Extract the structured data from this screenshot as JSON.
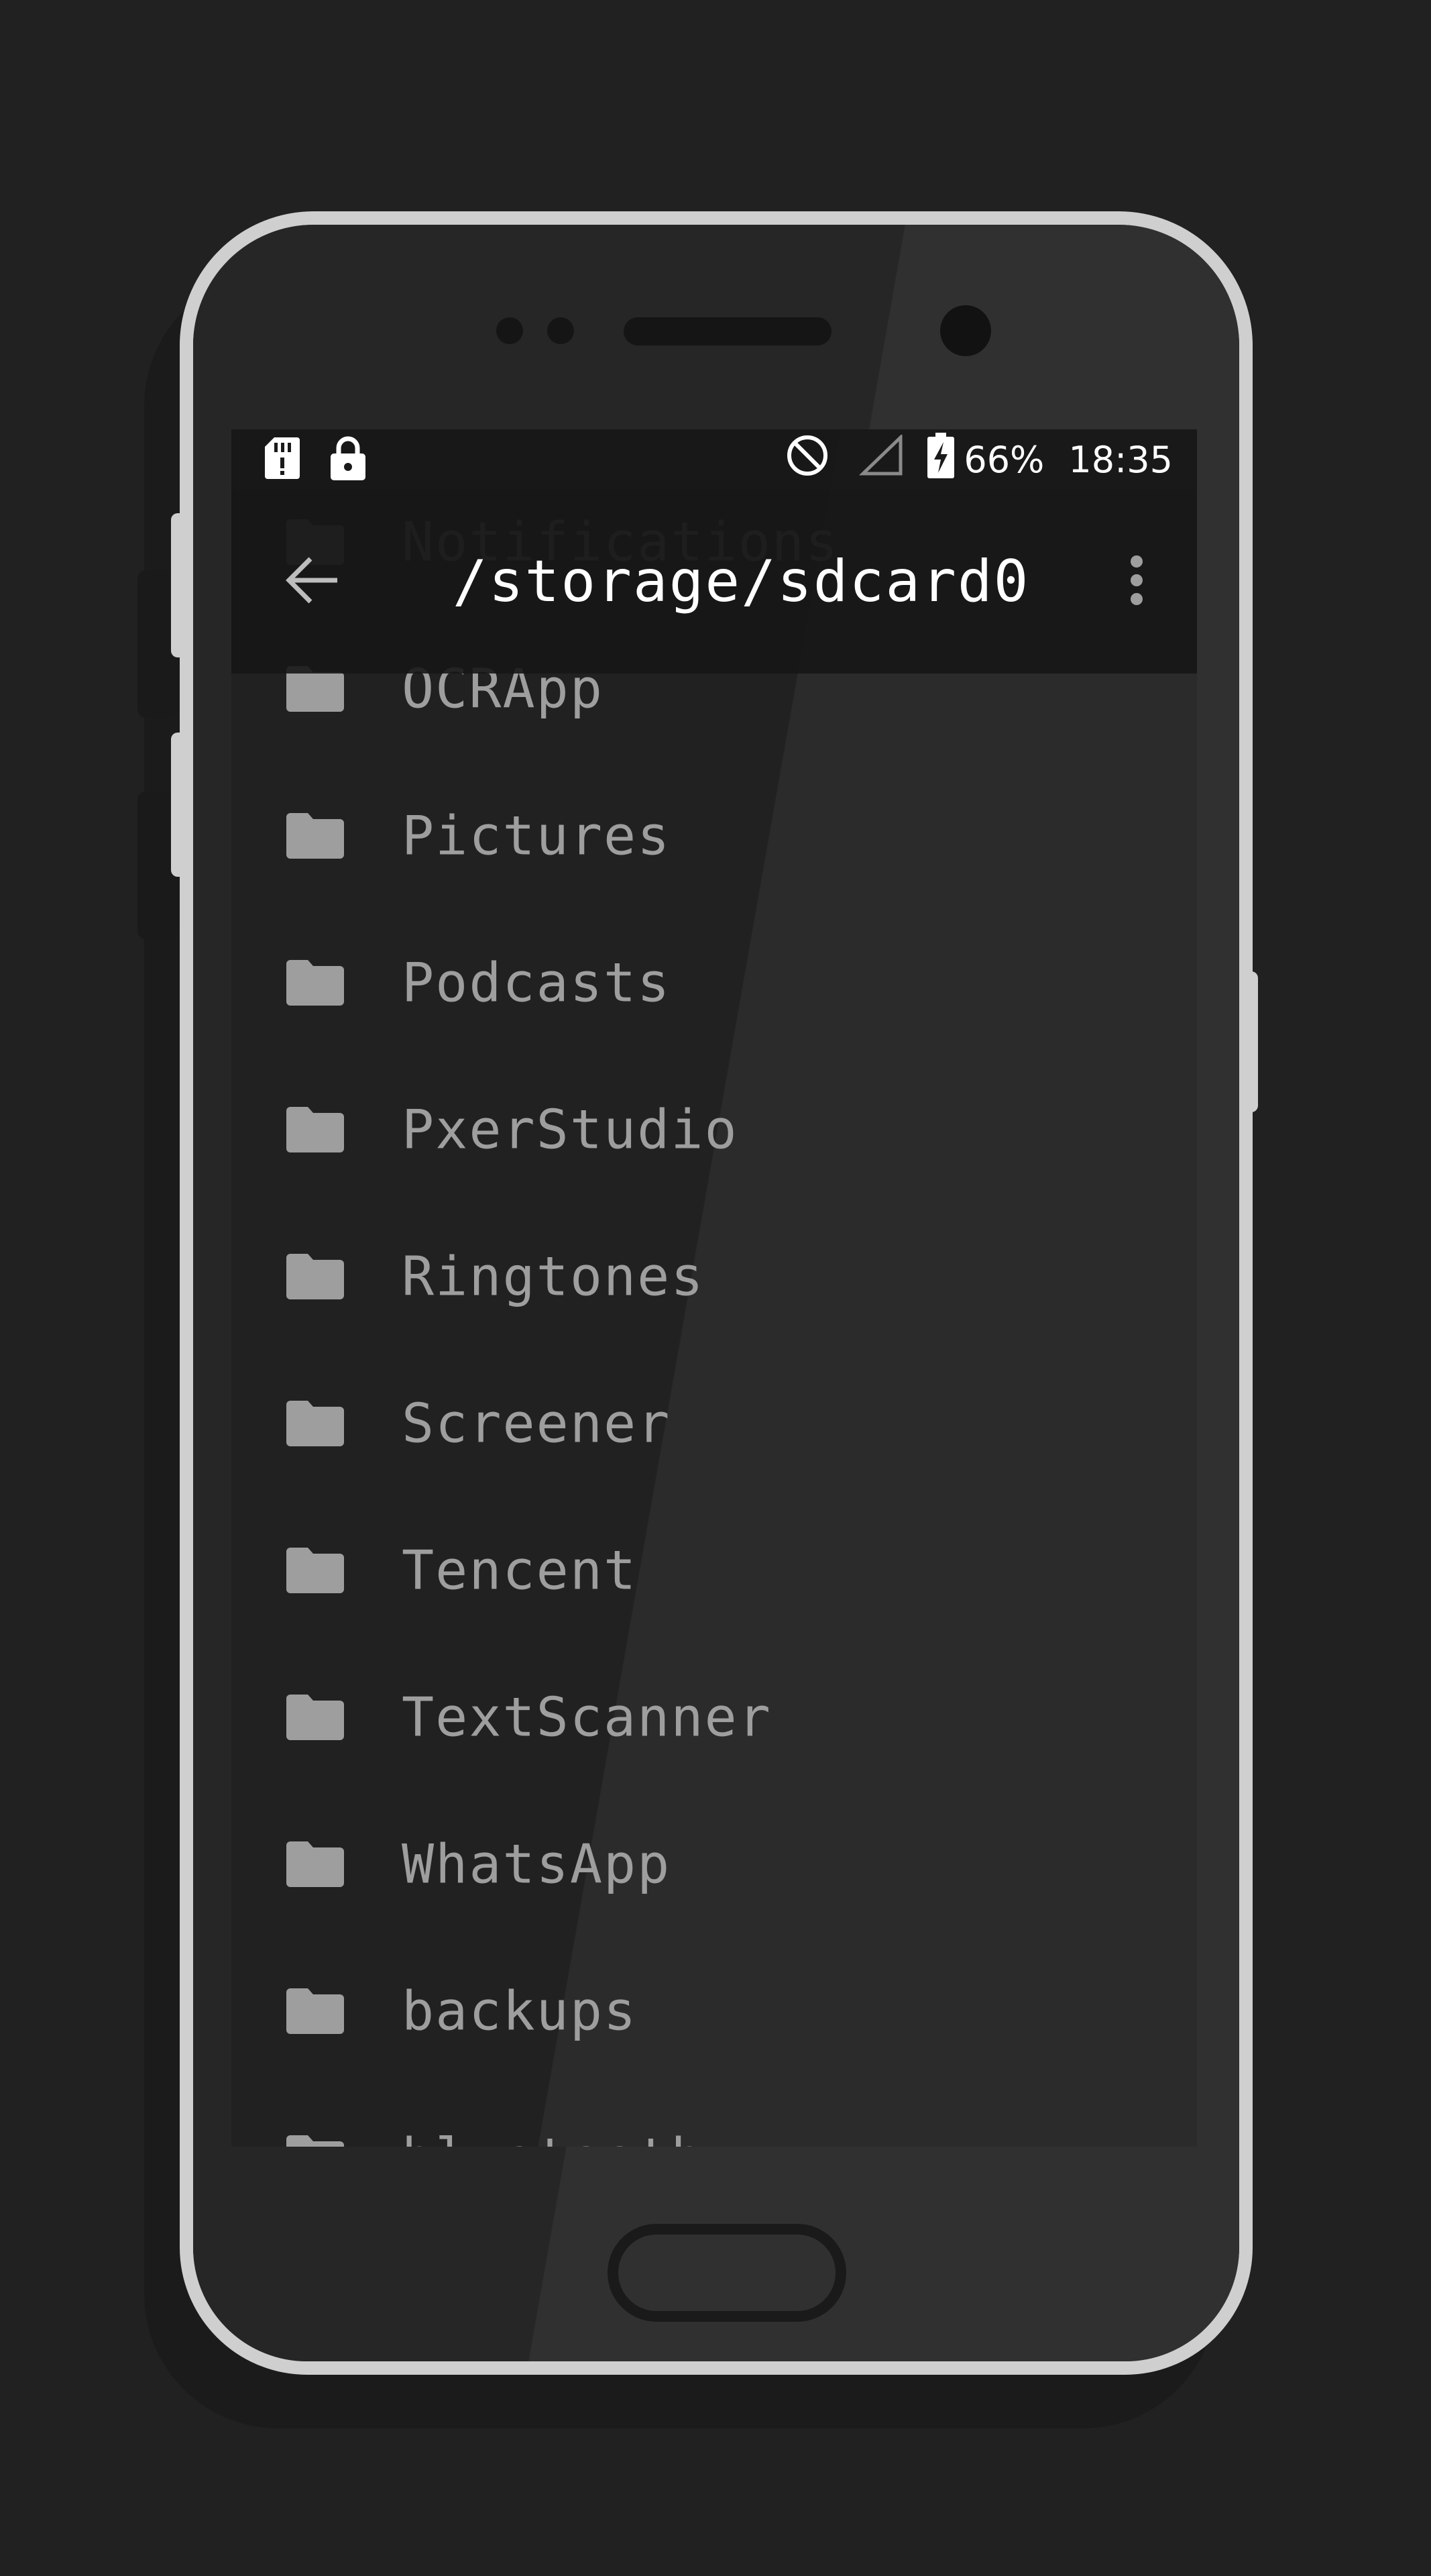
{
  "status_bar": {
    "left_icons": [
      "sd-card-icon",
      "lock-icon"
    ],
    "right_icons": [
      "do-not-disturb-icon",
      "signal-icon",
      "battery-charging-icon"
    ],
    "battery": "66%",
    "time": "18:35"
  },
  "toolbar": {
    "back_icon": "arrow-back-icon",
    "title": "/storage/sdcard0",
    "menu_icon": "more-vert-icon"
  },
  "file_list": {
    "folder_icon": "folder-icon",
    "items": [
      {
        "name": "Notifications"
      },
      {
        "name": "OCRApp"
      },
      {
        "name": "Pictures"
      },
      {
        "name": "Podcasts"
      },
      {
        "name": "PxerStudio"
      },
      {
        "name": "Ringtones"
      },
      {
        "name": "Screener"
      },
      {
        "name": "Tencent"
      },
      {
        "name": "TextScanner"
      },
      {
        "name": "WhatsApp"
      },
      {
        "name": "backups"
      },
      {
        "name": "bluetooth"
      }
    ]
  },
  "colors": {
    "background": "#212121",
    "phone_frame": "#cfcfcf",
    "text_primary": "#ffffff",
    "text_secondary": "#9e9e9e"
  }
}
